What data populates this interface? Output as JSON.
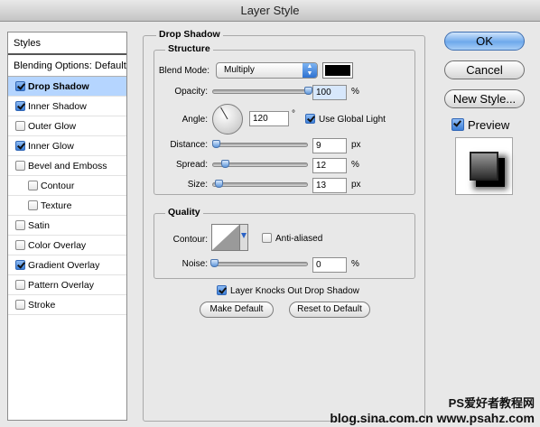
{
  "window": {
    "title": "Layer Style"
  },
  "sidebar": {
    "header": "Styles",
    "blending_options": "Blending Options: Default",
    "items": [
      {
        "label": "Drop Shadow",
        "checked": true,
        "active": true,
        "sub": false
      },
      {
        "label": "Inner Shadow",
        "checked": true,
        "active": false,
        "sub": false
      },
      {
        "label": "Outer Glow",
        "checked": false,
        "active": false,
        "sub": false
      },
      {
        "label": "Inner Glow",
        "checked": true,
        "active": false,
        "sub": false
      },
      {
        "label": "Bevel and Emboss",
        "checked": false,
        "active": false,
        "sub": false
      },
      {
        "label": "Contour",
        "checked": false,
        "active": false,
        "sub": true
      },
      {
        "label": "Texture",
        "checked": false,
        "active": false,
        "sub": true
      },
      {
        "label": "Satin",
        "checked": false,
        "active": false,
        "sub": false
      },
      {
        "label": "Color Overlay",
        "checked": false,
        "active": false,
        "sub": false
      },
      {
        "label": "Gradient Overlay",
        "checked": true,
        "active": false,
        "sub": false
      },
      {
        "label": "Pattern Overlay",
        "checked": false,
        "active": false,
        "sub": false
      },
      {
        "label": "Stroke",
        "checked": false,
        "active": false,
        "sub": false
      }
    ]
  },
  "drop_shadow": {
    "title": "Drop Shadow",
    "structure": {
      "title": "Structure",
      "blend_mode_label": "Blend Mode:",
      "blend_mode_value": "Multiply",
      "shadow_color": "#000000",
      "opacity_label": "Opacity:",
      "opacity_value": "100",
      "opacity_unit": "%",
      "opacity_level": 1.0,
      "angle_label": "Angle:",
      "angle_value": "120",
      "angle_unit": "°",
      "angle_degrees": 120,
      "use_global_light_label": "Use Global Light",
      "use_global_light": true,
      "distance_label": "Distance:",
      "distance_value": "9",
      "distance_unit": "px",
      "distance_level": 0.02,
      "spread_label": "Spread:",
      "spread_value": "12",
      "spread_unit": "%",
      "spread_level": 0.12,
      "size_label": "Size:",
      "size_value": "13",
      "size_unit": "px",
      "size_level": 0.05
    },
    "quality": {
      "title": "Quality",
      "contour_label": "Contour:",
      "anti_aliased_label": "Anti-aliased",
      "anti_aliased": false,
      "noise_label": "Noise:",
      "noise_value": "0",
      "noise_unit": "%",
      "noise_level": 0.0
    },
    "knocks_out_label": "Layer Knocks Out Drop Shadow",
    "knocks_out": true,
    "make_default": "Make Default",
    "reset_default": "Reset to Default"
  },
  "buttons": {
    "ok": "OK",
    "cancel": "Cancel",
    "new_style": "New Style...",
    "preview_label": "Preview",
    "preview": true
  },
  "watermark": {
    "line1": "PS爱好者教程网",
    "line2": "blog.sina.com.cn  www.psahz.com"
  }
}
